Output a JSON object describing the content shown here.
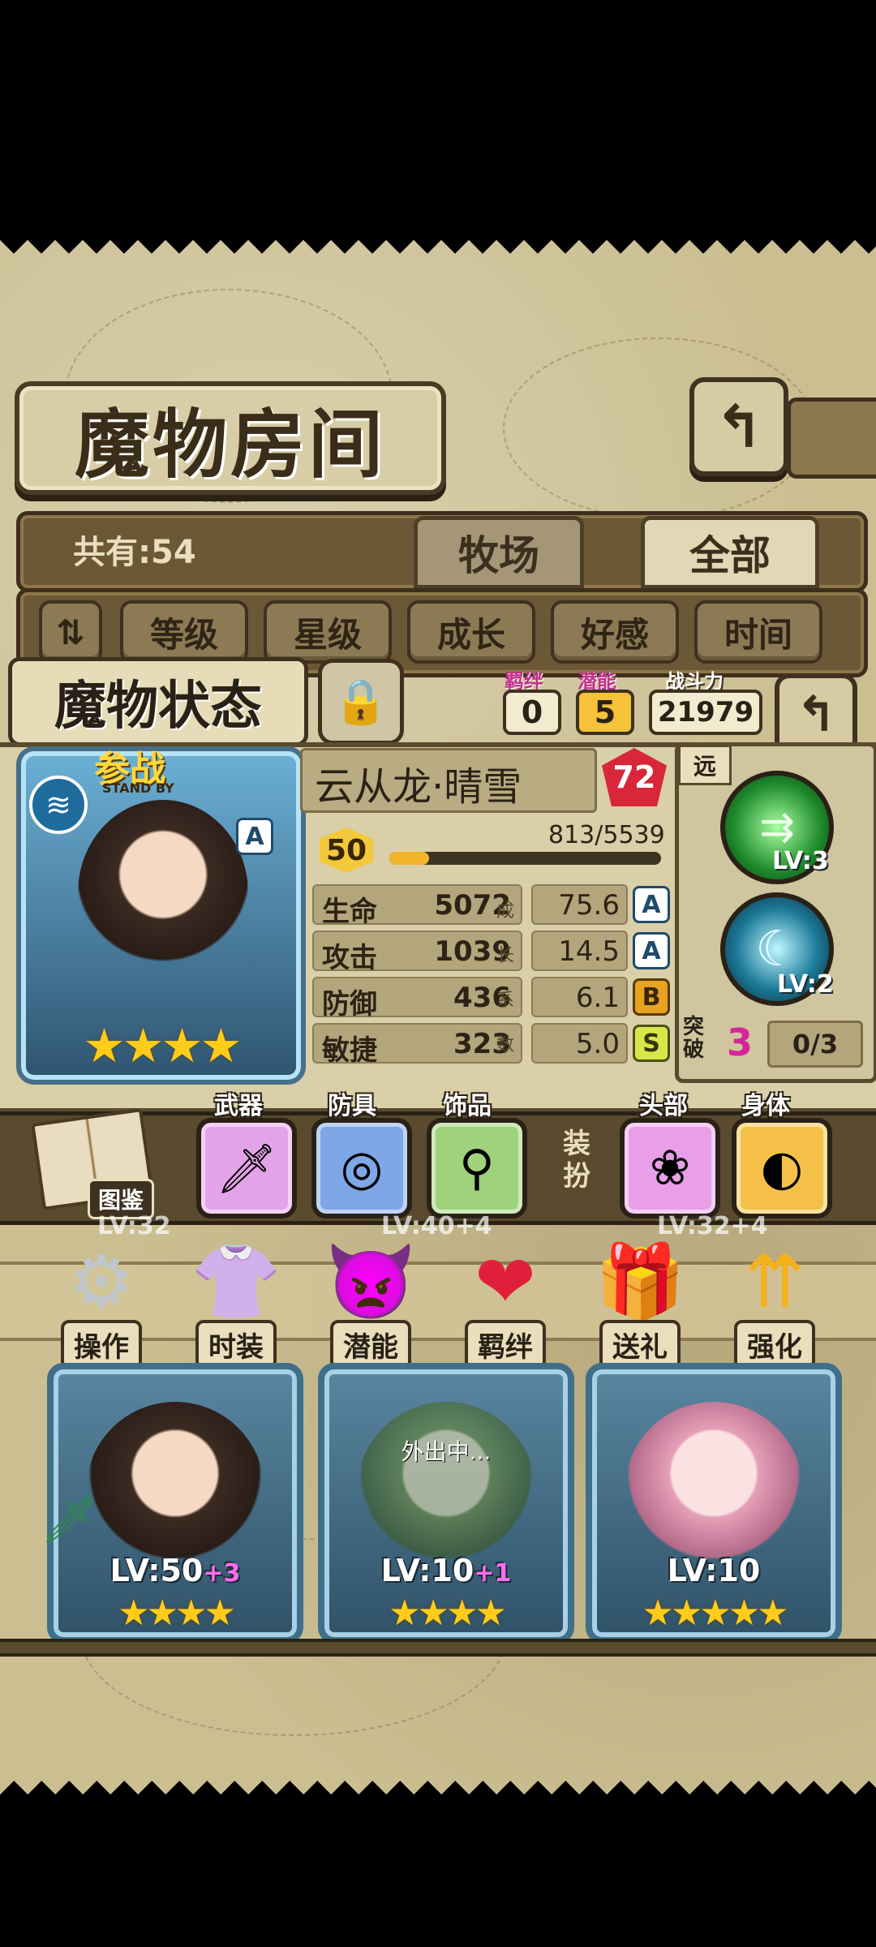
{
  "header": {
    "title": "魔物房间",
    "total_count": "共有:54",
    "tabs": [
      {
        "label": "牧场",
        "active": false
      },
      {
        "label": "全部",
        "active": true
      }
    ],
    "sort_buttons": [
      "等级",
      "星级",
      "成长",
      "好感",
      "时间"
    ],
    "back_icon": "return-arrow-icon"
  },
  "status_panel": {
    "title": "魔物状态",
    "lock_icon": "padlock-icon",
    "bond_label": "羁绊",
    "bond_value": "0",
    "potential_label": "潜能",
    "potential_value": "5",
    "power_label": "战斗力",
    "power_value": "21979",
    "monster_name": "云从龙·晴雪",
    "heart_value": "72",
    "standby_label": "参战",
    "standby_sub": "STAND BY",
    "portrait_grade": "A",
    "level": "50",
    "exp_text": "813/5539",
    "exp_fraction": 0.147,
    "stars": 4,
    "growth_vertical": [
      "成",
      "长",
      "系",
      "数"
    ],
    "stats": [
      {
        "name": "生命",
        "value": "5072",
        "growth": "75.6",
        "grade": "A"
      },
      {
        "name": "攻击",
        "value": "1039",
        "growth": "14.5",
        "grade": "A"
      },
      {
        "name": "防御",
        "value": "436",
        "growth": "6.1",
        "grade": "B"
      },
      {
        "name": "敏捷",
        "value": "323",
        "growth": "5.0",
        "grade": "S"
      }
    ],
    "range_tag": "远",
    "skills": [
      {
        "level": "LV:3",
        "icon": "arrow-volley-skill-icon"
      },
      {
        "level": "LV:2",
        "icon": "crescent-slash-skill-icon"
      }
    ],
    "breakthrough_label": "突破",
    "breakthrough_value": "3",
    "breakthrough_progress": "0/3"
  },
  "equipment": {
    "book_label": "图鉴",
    "slots": [
      {
        "label": "武器",
        "icon": "sword-icon"
      },
      {
        "label": "防具",
        "icon": "shield-icon"
      },
      {
        "label": "饰品",
        "icon": "wand-icon"
      }
    ],
    "dress_label": "装扮",
    "dress_slots": [
      {
        "label": "头部",
        "icon": "hair-ornament-icon"
      },
      {
        "label": "身体",
        "icon": "ring-icon"
      }
    ]
  },
  "actions": [
    {
      "label": "操作",
      "icon": "gear-icon"
    },
    {
      "label": "时装",
      "icon": "outfit-icon"
    },
    {
      "label": "潜能",
      "icon": "demon-icon"
    },
    {
      "label": "羁绊",
      "icon": "hearts-icon"
    },
    {
      "label": "送礼",
      "icon": "gift-icon"
    },
    {
      "label": "强化",
      "icon": "upgrade-arrows-icon"
    }
  ],
  "monster_list": [
    {
      "level": "LV:50",
      "plus": "+3",
      "stars": 4,
      "status": ""
    },
    {
      "level": "LV:10",
      "plus": "+1",
      "stars": 4,
      "status": "外出中..."
    },
    {
      "level": "LV:10",
      "plus": "",
      "stars": 5,
      "status": ""
    }
  ],
  "hidden_row_levels": [
    "LV:32",
    "LV:40+4",
    "LV:32+4"
  ],
  "colors": {
    "panel_bg": "#d9cfa8",
    "frame_dark": "#3e311f",
    "star_gold": "#ffcc1a",
    "card_blue": "#3f6f8a",
    "accent_pink": "#c22f8b"
  }
}
